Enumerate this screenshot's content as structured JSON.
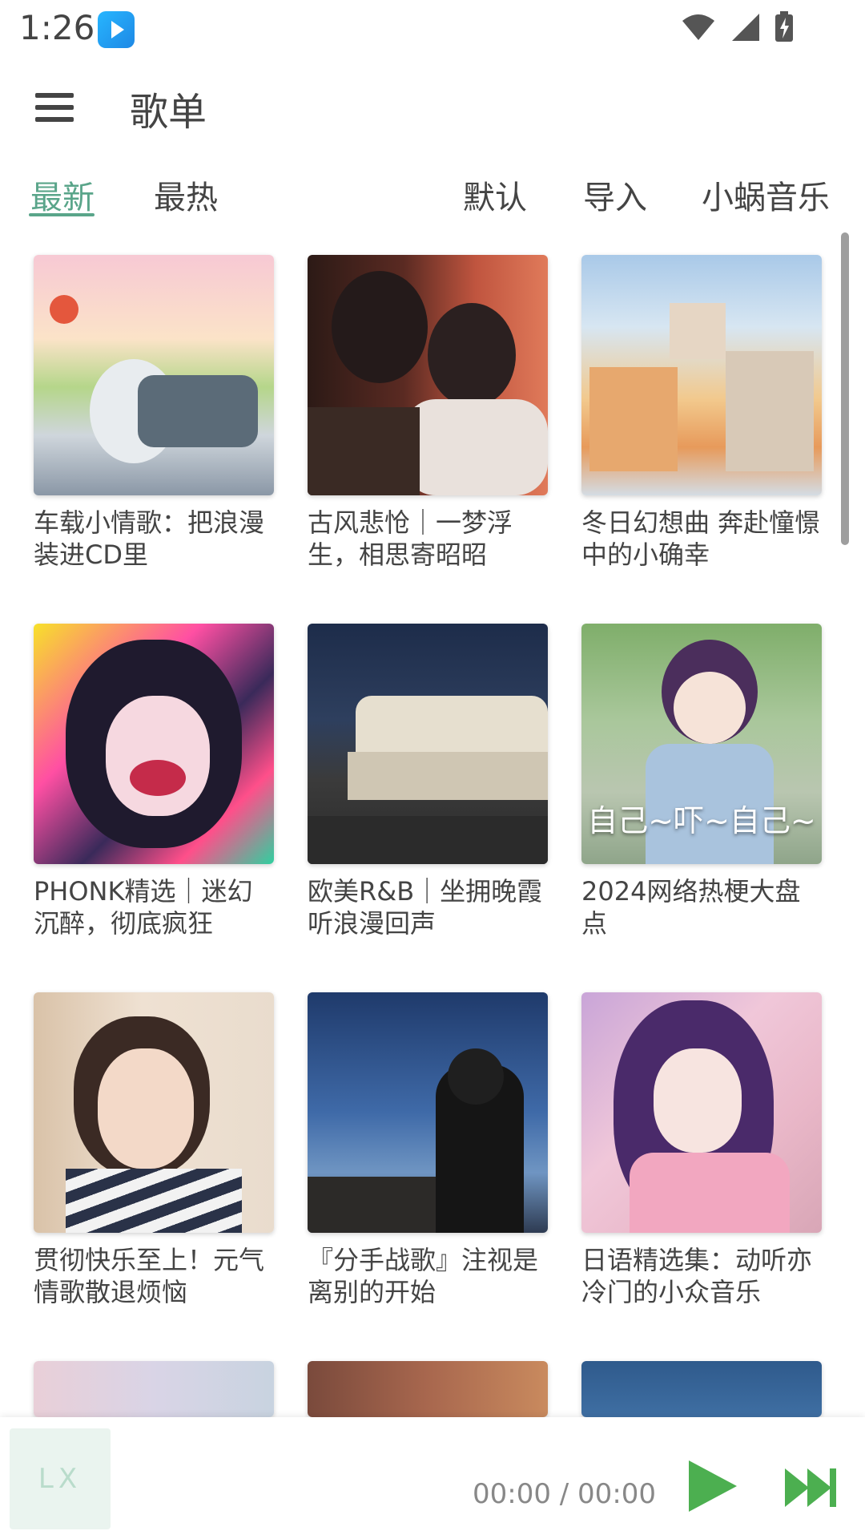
{
  "status": {
    "time": "1:26"
  },
  "header": {
    "title": "歌单"
  },
  "tabs": {
    "left": [
      {
        "label": "最新"
      },
      {
        "label": "最热"
      }
    ],
    "right": [
      {
        "label": "默认"
      },
      {
        "label": "导入"
      },
      {
        "label": "小蜗音乐"
      }
    ]
  },
  "playlists": [
    {
      "title": "车载小情歌：把浪漫装进CD里"
    },
    {
      "title": "古风悲怆｜一梦浮生，相思寄昭昭"
    },
    {
      "title": "冬日幻想曲 奔赴憧憬中的小确幸"
    },
    {
      "title": "PHONK精选｜迷幻沉醉，彻底疯狂"
    },
    {
      "title": "欧美R&B｜坐拥晚霞听浪漫回声"
    },
    {
      "title": "2024网络热梗大盘点",
      "cover_text": "自己~吓~自己~"
    },
    {
      "title": "贯彻快乐至上！元气情歌散退烦恼"
    },
    {
      "title": "『分手战歌』注视是离别的开始"
    },
    {
      "title": "日语精选集：动听亦冷门的小众音乐"
    }
  ],
  "player": {
    "logo": "LX",
    "time": "00:00 / 00:00"
  },
  "colors": {
    "accent": "#5aa58a",
    "player_icon": "#4caf50"
  }
}
